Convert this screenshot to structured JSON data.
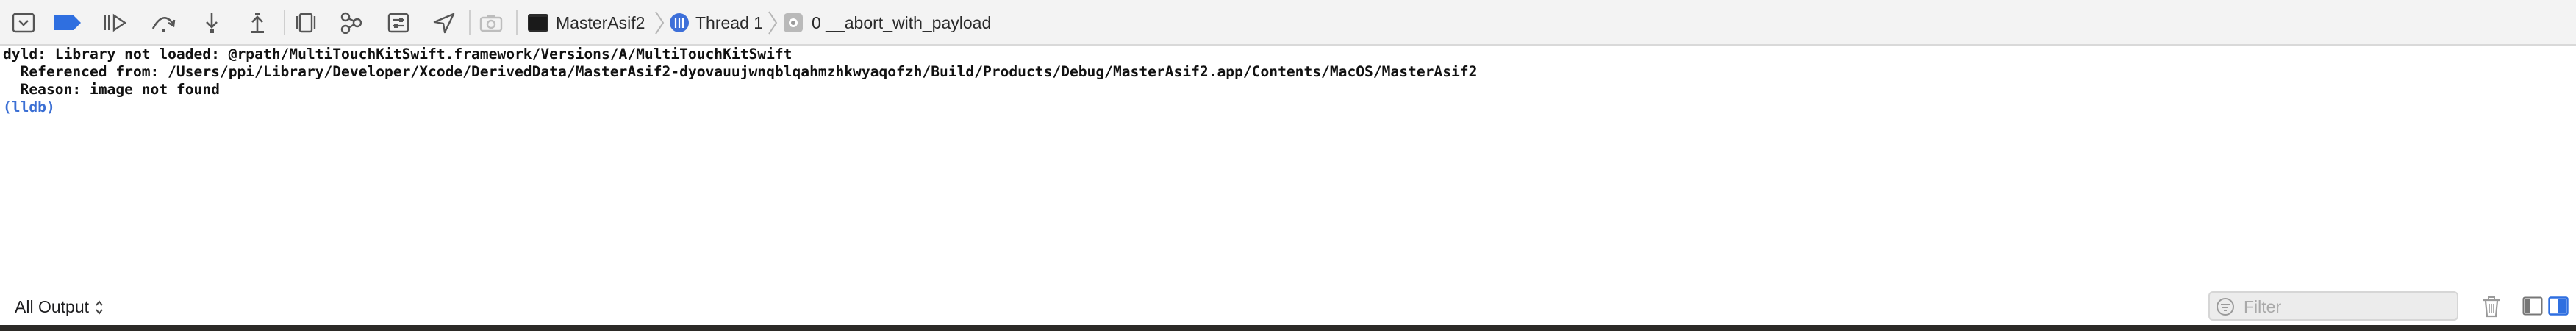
{
  "toolbar": {
    "buttons": [
      {
        "name": "hide-debug-area-icon"
      },
      {
        "name": "breakpoints-toggle-icon"
      },
      {
        "name": "continue-icon"
      },
      {
        "name": "step-over-icon"
      },
      {
        "name": "step-into-icon"
      },
      {
        "name": "step-out-icon"
      },
      {
        "name": "debug-view-hierarchy-icon"
      },
      {
        "name": "debug-memory-graph-icon"
      },
      {
        "name": "environment-overrides-icon"
      },
      {
        "name": "simulate-location-icon"
      },
      {
        "name": "capture-gpu-frame-icon"
      }
    ],
    "breadcrumb": {
      "target": "MasterAsif2",
      "thread": "Thread 1",
      "frame": "0 __abort_with_payload"
    },
    "accent": "#2f6fe0"
  },
  "console": {
    "lines": [
      "dyld: Library not loaded: @rpath/MultiTouchKitSwift.framework/Versions/A/MultiTouchKitSwift",
      "  Referenced from: /Users/ppi/Library/Developer/Xcode/DerivedData/MasterAsif2-dyovauujwnqblqahmzhkwyaqofzh/Build/Products/Debug/MasterAsif2.app/Contents/MacOS/MasterAsif2",
      "  Reason: image not found"
    ],
    "prompt": "(lldb)"
  },
  "bottom": {
    "scope_label": "All Output",
    "filter_placeholder": "Filter"
  }
}
